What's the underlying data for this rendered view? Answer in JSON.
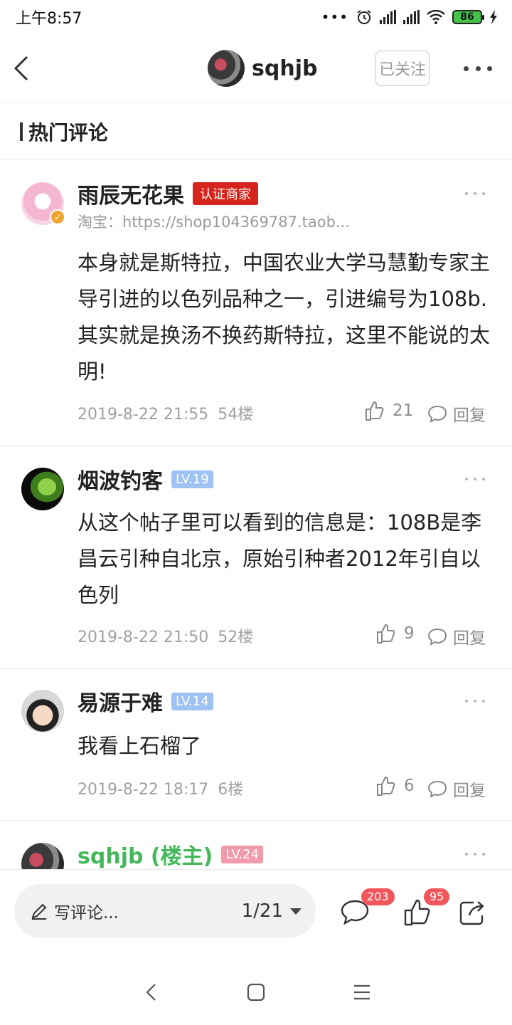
{
  "status_bar": {
    "time": "上午8:57",
    "battery": "86"
  },
  "header": {
    "username": "sqhjb",
    "follow_label": "已关注"
  },
  "section": {
    "title": "热门评论"
  },
  "comments": [
    {
      "name": "雨辰无花果",
      "tag": "认证商家",
      "subtitle": "淘宝：https://shop104369787.taob...",
      "text": "本身就是斯特拉，中国农业大学马慧勤专家主导引进的以色列品种之一，引进编号为108b.其实就是换汤不换药斯特拉，这里不能说的太明!",
      "date": "2019-8-22 21:55",
      "floor": "54楼",
      "likes": "21",
      "reply_label": "回复"
    },
    {
      "name": "烟波钓客",
      "tag": "LV.19",
      "text": "从这个帖子里可以看到的信息是：108B是李昌云引种自北京，原始引种者2012年引自以色列",
      "date": "2019-8-22 21:50",
      "floor": "52楼",
      "likes": "9",
      "reply_label": "回复"
    },
    {
      "name": "易源于难",
      "tag": "LV.14",
      "text": "我看上石榴了",
      "date": "2019-8-22 18:17",
      "floor": "6楼",
      "likes": "6",
      "reply_label": "回复"
    },
    {
      "name": "sqhjb (楼主)",
      "tag": "LV.24"
    }
  ],
  "bottom_bar": {
    "comment_placeholder": "写评论...",
    "page": "1/21",
    "comment_count": "203",
    "like_count": "95"
  },
  "colors": {
    "merchant_tag": "#d6231c",
    "level_tag": "#9ec2f2",
    "host_level_tag": "#f19aa9",
    "host_name": "#44b85a",
    "badge": "#f2555a"
  }
}
